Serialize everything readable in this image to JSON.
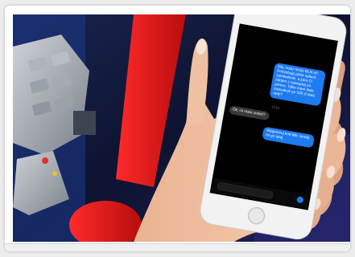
{
  "image": {
    "alt": "Hand holding a smartphone with a text-message conversation in front of an ATM keypad and a large red exclamation mark"
  },
  "phone": {
    "messages": [
      {
        "side": "sent",
        "lines": [
          "Hej, masz może BLIK-a?",
          "Potrzebuję pilnie spłacić",
          "zamówienie, a jutro Ci",
          "oddam z nawiązką za",
          "pomoc. Tylko mam dwie",
          "transakcje po 500 zł dasz",
          "rady?"
        ]
      },
      {
        "side": "time",
        "lines": [
          "12:21"
        ]
      },
      {
        "side": "received",
        "lines": [
          "Ok, co mam zrobić?"
        ]
      },
      {
        "side": "sent",
        "lines": [
          "Wygeneruj kod blik i podaj",
          "mi go tutaj"
        ]
      }
    ]
  },
  "colors": {
    "sent_bubble": "#1e7bf0",
    "received_bubble": "#3a3a3c",
    "exclamation": "#e11414",
    "phone_frame": "#f2f2f2"
  }
}
